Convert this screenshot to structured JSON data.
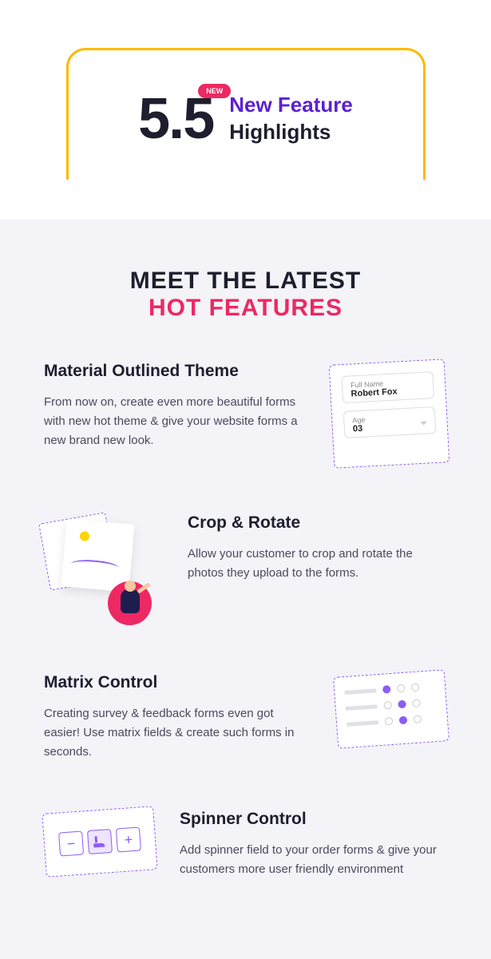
{
  "hero": {
    "version": "5.5",
    "badge": "NEW",
    "line1": "New Feature",
    "line2": "Highlights"
  },
  "section": {
    "title": "MEET THE LATEST",
    "subtitle": "HOT FEATURES"
  },
  "features": [
    {
      "title": "Material Outlined Theme",
      "desc": "From now on, create even more beautiful forms with new hot theme & give your website forms a new brand new look."
    },
    {
      "title": "Crop & Rotate",
      "desc": "Allow your customer to crop and rotate the photos they upload to the forms."
    },
    {
      "title": "Matrix Control",
      "desc": "Creating survey & feedback forms even got easier! Use matrix fields & create such forms in seconds."
    },
    {
      "title": "Spinner Control",
      "desc": "Add spinner field to your order forms & give your customers more user friendly environment"
    }
  ],
  "form_illustration": {
    "field1_label": "Full Name",
    "field1_value": "Robert Fox",
    "field2_label": "Age",
    "field2_value": "03"
  },
  "spinner_illustration": {
    "minus": "−",
    "plus": "+"
  }
}
